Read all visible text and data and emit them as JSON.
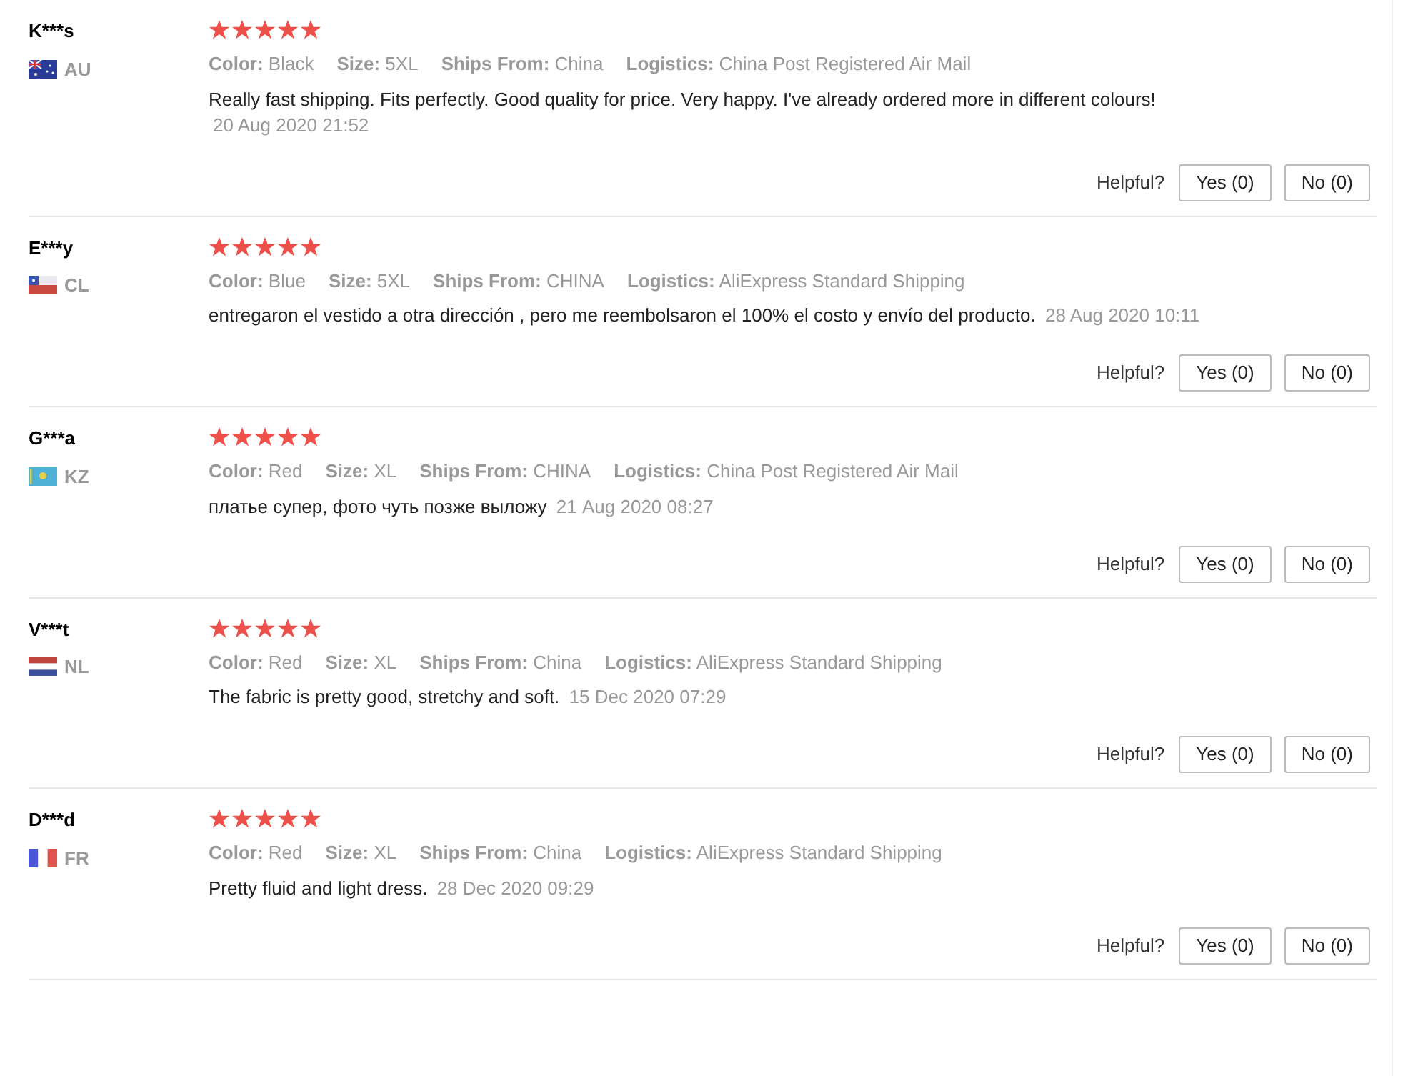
{
  "reviews": [
    {
      "name": "K***s",
      "kind": "au",
      "country": "AU",
      "stars": 5,
      "attributes": [
        {
          "label": "Color:",
          "value": "Black"
        },
        {
          "label": "Size:",
          "value": "5XL"
        },
        {
          "label": "Ships From:",
          "value": "China"
        },
        {
          "label": "Logistics:",
          "value": "China Post Registered Air Mail"
        }
      ],
      "text": "Really fast shipping. Fits perfectly. Good quality for price. Very happy. I've already ordered more in different colours!",
      "date": "20 Aug 2020 21:52",
      "helpful_label": "Helpful?",
      "yes": "Yes (0)",
      "no": "No (0)"
    },
    {
      "name": "E***y",
      "kind": "cl",
      "country": "CL",
      "stars": 5,
      "attributes": [
        {
          "label": "Color:",
          "value": "Blue"
        },
        {
          "label": "Size:",
          "value": "5XL"
        },
        {
          "label": "Ships From:",
          "value": "CHINA"
        },
        {
          "label": "Logistics:",
          "value": "AliExpress Standard Shipping"
        }
      ],
      "text": "entregaron el vestido a otra dirección , pero me reembolsaron el 100% el costo y envío del producto.",
      "date": "28 Aug 2020 10:11",
      "helpful_label": "Helpful?",
      "yes": "Yes (0)",
      "no": "No (0)"
    },
    {
      "name": "G***a",
      "kind": "kz",
      "country": "KZ",
      "stars": 5,
      "attributes": [
        {
          "label": "Color:",
          "value": "Red"
        },
        {
          "label": "Size:",
          "value": "XL"
        },
        {
          "label": "Ships From:",
          "value": "CHINA"
        },
        {
          "label": "Logistics:",
          "value": "China Post Registered Air Mail"
        }
      ],
      "text": "платье супер, фото чуть позже выложу",
      "date": "21 Aug 2020 08:27",
      "helpful_label": "Helpful?",
      "yes": "Yes (0)",
      "no": "No (0)"
    },
    {
      "name": "V***t",
      "kind": "nl",
      "country": "NL",
      "stars": 5,
      "attributes": [
        {
          "label": "Color:",
          "value": "Red"
        },
        {
          "label": "Size:",
          "value": "XL"
        },
        {
          "label": "Ships From:",
          "value": "China"
        },
        {
          "label": "Logistics:",
          "value": "AliExpress Standard Shipping"
        }
      ],
      "text": "The fabric is pretty good, stretchy and soft.",
      "date": "15 Dec 2020 07:29",
      "helpful_label": "Helpful?",
      "yes": "Yes (0)",
      "no": "No (0)"
    },
    {
      "name": "D***d",
      "kind": "fr",
      "country": "FR",
      "stars": 5,
      "attributes": [
        {
          "label": "Color:",
          "value": "Red"
        },
        {
          "label": "Size:",
          "value": "XL"
        },
        {
          "label": "Ships From:",
          "value": "China"
        },
        {
          "label": "Logistics:",
          "value": "AliExpress Standard Shipping"
        }
      ],
      "text": "Pretty fluid and light dress.",
      "date": "28 Dec 2020 09:29",
      "helpful_label": "Helpful?",
      "yes": "Yes (0)",
      "no": "No (0)"
    }
  ]
}
